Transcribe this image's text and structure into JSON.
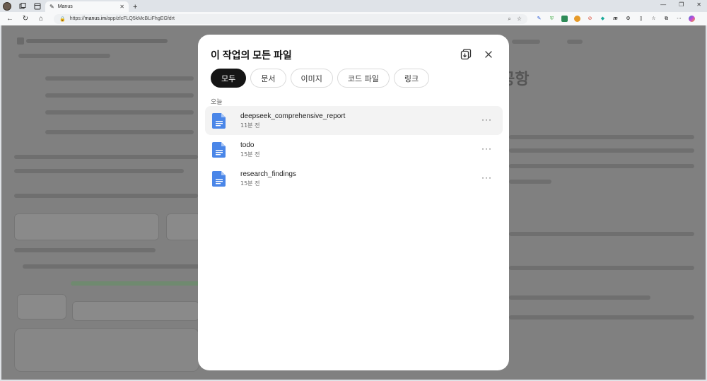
{
  "browser": {
    "tab_title": "Manus",
    "url_prefix": "https://",
    "url_domain": "manus.im",
    "url_path": "/app/zlcFLQ5kMcBLiFhgEGfdrt"
  },
  "background": {
    "heading_fragment": "공항"
  },
  "modal": {
    "title": "이 작업의 모든 파일",
    "tabs": [
      {
        "label": "모두",
        "active": true
      },
      {
        "label": "문서",
        "active": false
      },
      {
        "label": "이미지",
        "active": false
      },
      {
        "label": "코드 파일",
        "active": false
      },
      {
        "label": "링크",
        "active": false
      }
    ],
    "section_label": "오늘",
    "files": [
      {
        "name": "deepseek_comprehensive_report",
        "time": "11분 전"
      },
      {
        "name": "todo",
        "time": "15분 전"
      },
      {
        "name": "research_findings",
        "time": "15분 전"
      }
    ],
    "more_label": "···"
  },
  "colors": {
    "doc_icon": "#4a86e8",
    "active_tab": "#151515",
    "overlay": "#808080"
  }
}
